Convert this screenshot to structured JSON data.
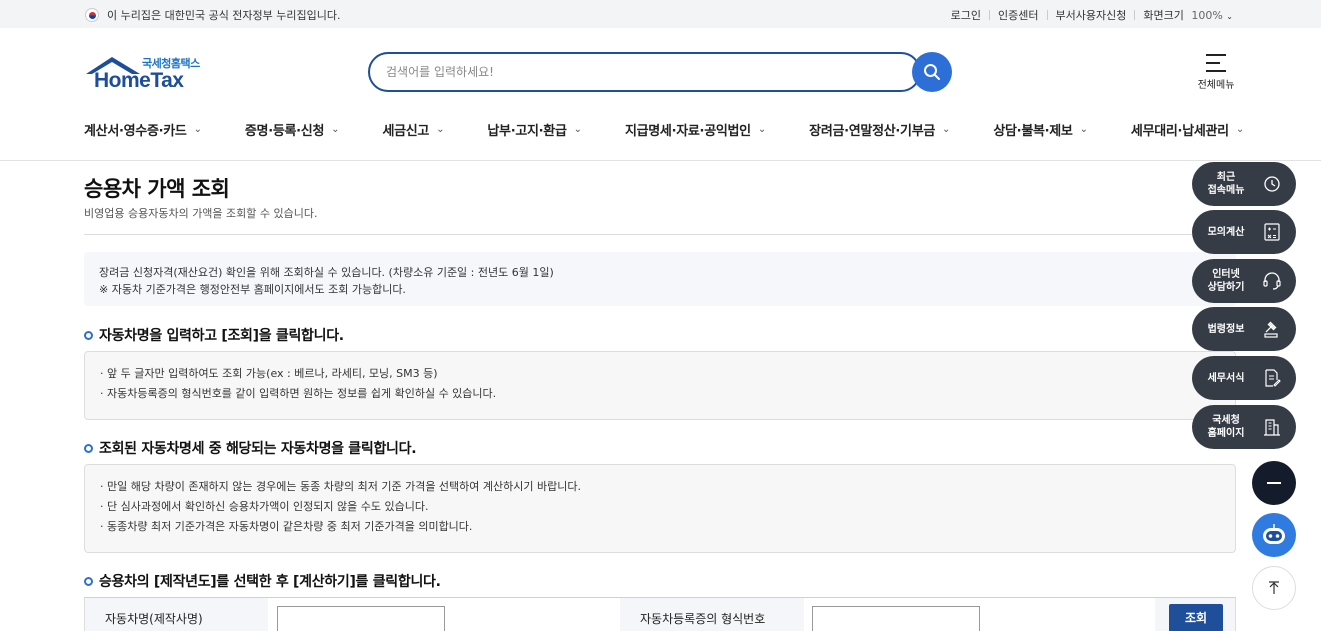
{
  "topbar": {
    "gov_notice": "이 누리집은 대한민국 공식 전자정부 누리집입니다.",
    "links": [
      "로그인",
      "인증센터",
      "부서사용자신청"
    ],
    "zoom_label": "화면크기",
    "zoom_value": "100%"
  },
  "header": {
    "logo_sub": "국세청홈택스",
    "logo_main": "HomeTax",
    "search_placeholder": "검색어를 입력하세요!",
    "allmenu_label": "전체메뉴"
  },
  "gnb": [
    "계산서·영수증·카드",
    "증명·등록·신청",
    "세금신고",
    "납부·고지·환급",
    "지급명세·자료·공익법인",
    "장려금·연말정산·기부금",
    "상담·불복·제보",
    "세무대리·납세관리"
  ],
  "page": {
    "title": "승용차 가액 조회",
    "desc": "비영업용 승용자동차의 가액을 조회할 수 있습니다."
  },
  "notice": [
    "장려금 신청자격(재산요건) 확인을 위해 조회하실 수 있습니다. (차량소유 기준일 : 전년도 6월 1일)",
    "※ 자동차 기준가격은 행정안전부 홈페이지에서도 조회 가능합니다."
  ],
  "sections": [
    {
      "heading": "자동차명을 입력하고 [조회]을 클릭합니다.",
      "bullets": [
        "· 앞 두 글자만 입력하여도 조회 가능(ex : 베르나, 라세티, 모닝, SM3 등)",
        "· 자동차등록증의 형식번호를 같이 입력하면 원하는 정보를 쉽게 확인하실 수 있습니다."
      ]
    },
    {
      "heading": "조회된 자동차명세 중 해당되는 자동차명을 클릭합니다.",
      "bullets": [
        "· 만일 해당 차량이 존재하지 않는 경우에는 동종 차량의 최저 기준 가격을 선택하여 계산하시기 바랍니다.",
        "· 단 심사과정에서 확인하신 승용차가액이 인정되지 않을 수도 있습니다.",
        "· 동종차량 최저 기준가격은 자동차명이 같은차량 중  최저 기준가격을 의미합니다."
      ]
    },
    {
      "heading": "승용차의 [제작년도]를 선택한 후 [계산하기]를 클릭합니다."
    }
  ],
  "form": {
    "car_name_label": "자동차명(제작사명)",
    "car_name_value": "",
    "type_no_label": "자동차등록증의 형식번호",
    "type_no_value": "",
    "search_button": "조회"
  },
  "quick_menu": [
    {
      "label": "최근\n접속메뉴",
      "icon": "clock-icon"
    },
    {
      "label": "모의계산",
      "icon": "calculator-icon"
    },
    {
      "label": "인터넷\n상담하기",
      "icon": "headset-icon"
    },
    {
      "label": "법령정보",
      "icon": "gavel-icon"
    },
    {
      "label": "세무서식",
      "icon": "document-edit-icon"
    },
    {
      "label": "국세청\n홈페이지",
      "icon": "building-icon"
    }
  ],
  "colors": {
    "brand_blue": "#1f4e9b",
    "accent_blue": "#2d6fd6",
    "quick_bg": "#353c45"
  }
}
